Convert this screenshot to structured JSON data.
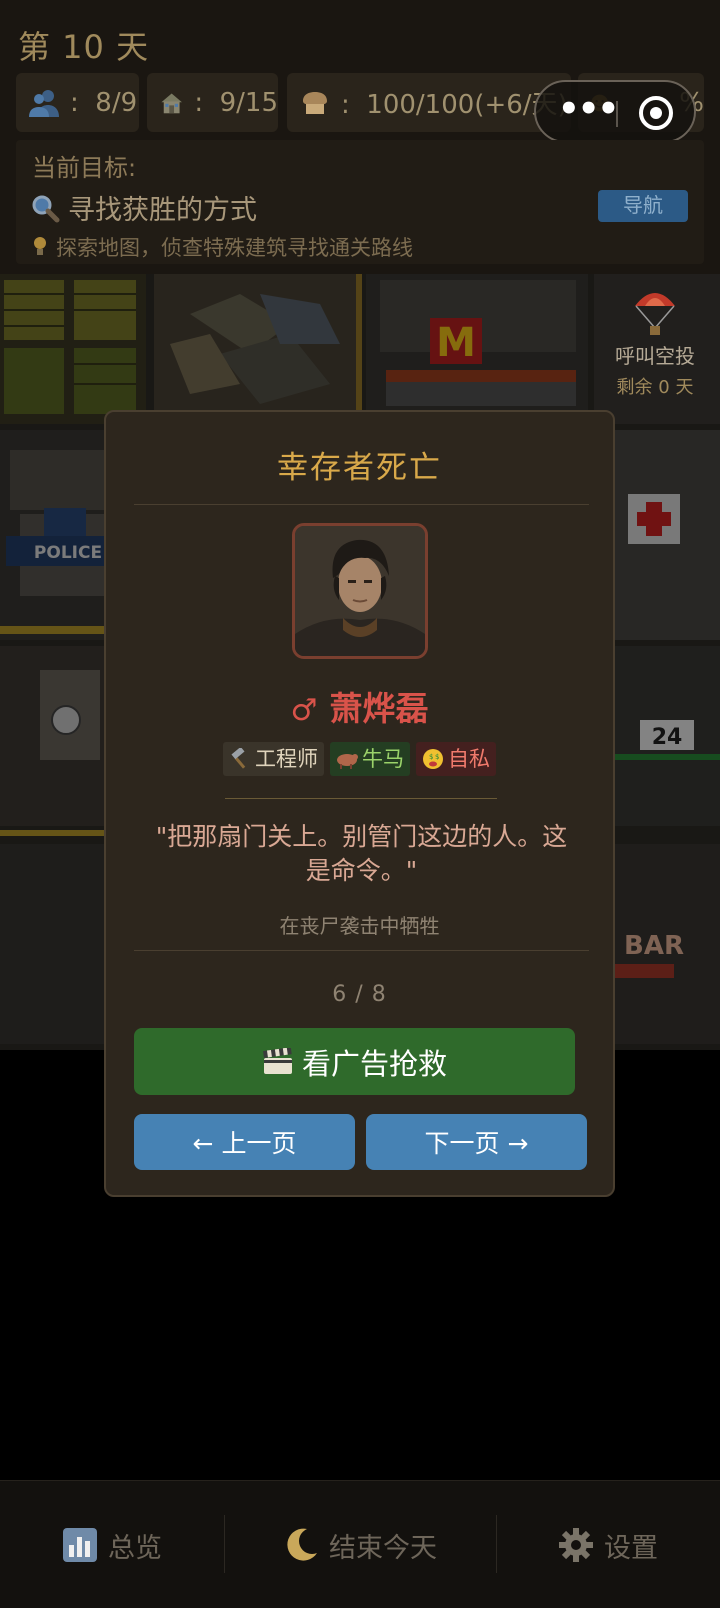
{
  "hud": {
    "day": "第 10 天",
    "stats": {
      "survivors": "8/9",
      "housing": "9/15",
      "food": "100/100(+6/天)",
      "mood_partial": "%"
    },
    "goal": {
      "label": "当前目标:",
      "text": "寻找获胜的方式",
      "hint": "探索地图，侦查特殊建筑寻找通关路线",
      "nav_button": "导航"
    }
  },
  "map": {
    "police_sign": "POLICE",
    "store_sign": "24",
    "bar_sign": "BAR",
    "airdrop": {
      "label": "呼叫空投",
      "remaining": "剩余 0 天"
    }
  },
  "modal": {
    "title": "幸存者死亡",
    "survivor": {
      "gender_symbol": "♂",
      "name": "萧烨磊",
      "tags": [
        {
          "label": "工程师",
          "icon": "hammer-icon"
        },
        {
          "label": "牛马",
          "icon": "ox-icon"
        },
        {
          "label": "自私",
          "icon": "money-face-icon"
        }
      ],
      "quote": "\"把那扇门关上。别管门这边的人。这是命令。\"",
      "cause": "在丧尸袭击中牺牲"
    },
    "page_indicator": "6 / 8",
    "buttons": {
      "watch_ad": "看广告抢救",
      "prev": "← 上一页",
      "next": "下一页 →"
    }
  },
  "bottom_bar": {
    "overview": "总览",
    "end_day": "结束今天",
    "settings": "设置"
  },
  "colors": {
    "modal_bg": "#2d261d",
    "title_gold": "#d9a94a",
    "name_red": "#d9534a",
    "ad_green": "#2f6a2b",
    "nav_blue": "#4682b4"
  }
}
